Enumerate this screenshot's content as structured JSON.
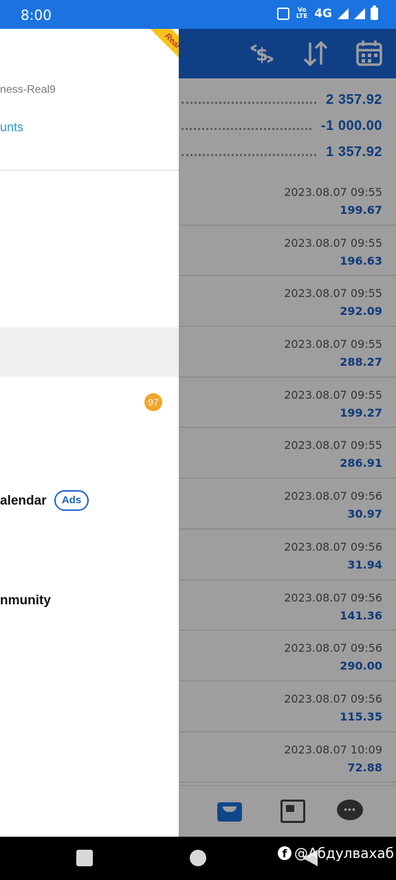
{
  "status_bar": {
    "time": "8:00",
    "network": "4G",
    "volte": "Vo LTE"
  },
  "drawer": {
    "account_name": "ness-Real9",
    "manage_accounts": "unts",
    "badge_count": "97",
    "menu_calendar": "alendar",
    "ads_label": "Ads",
    "menu_community": "nmunity",
    "ribbon": "Real"
  },
  "summary": {
    "deposit": "2 357.92",
    "withdrawal": "-1 000.00",
    "balance": "1 357.92"
  },
  "deals": [
    {
      "date": "2023.08.07 09:55",
      "amount": "199.67"
    },
    {
      "date": "2023.08.07 09:55",
      "amount": "196.63"
    },
    {
      "date": "2023.08.07 09:55",
      "amount": "292.09"
    },
    {
      "date": "2023.08.07 09:55",
      "amount": "288.27"
    },
    {
      "date": "2023.08.07 09:55",
      "amount": "199.27"
    },
    {
      "date": "2023.08.07 09:55",
      "amount": "286.91"
    },
    {
      "date": "2023.08.07 09:56",
      "amount": "30.97"
    },
    {
      "date": "2023.08.07 09:56",
      "amount": "31.94"
    },
    {
      "date": "2023.08.07 09:56",
      "amount": "141.36"
    },
    {
      "date": "2023.08.07 09:56",
      "amount": "290.00"
    },
    {
      "date": "2023.08.07 09:56",
      "amount": "115.35"
    },
    {
      "date": "2023.08.07 10:09",
      "amount": "72.88"
    }
  ],
  "watermark": "@Абдулвахаб",
  "icons": {
    "toolbar": [
      "currency-exchange-icon",
      "sort-icon",
      "calendar-icon"
    ],
    "bottom_nav": [
      "inbox-icon",
      "news-icon",
      "chat-icon"
    ]
  },
  "colors": {
    "accent": "#1a73e0",
    "amount": "#1a5fc8",
    "badge": "#f0a52a",
    "ribbon": "#f6c21b"
  }
}
